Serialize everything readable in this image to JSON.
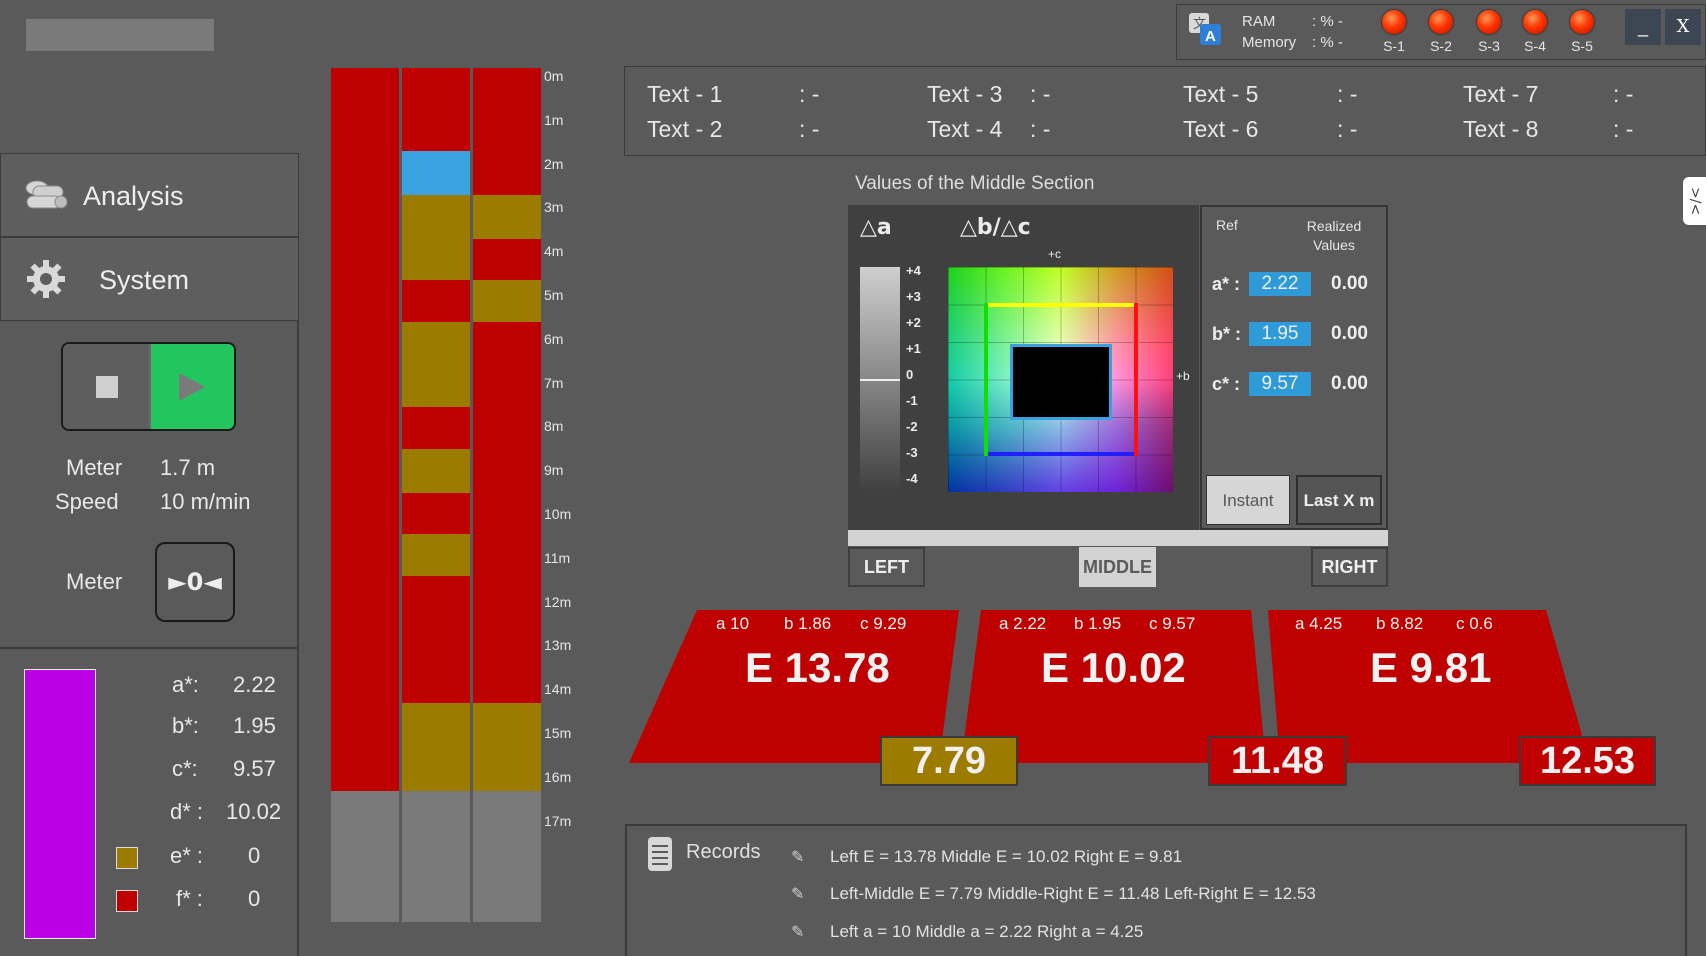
{
  "status": {
    "ram_label": "RAM",
    "ram_value": ": % -",
    "memory_label": "Memory",
    "memory_value": ": % -",
    "sensors": [
      "S-1",
      "S-2",
      "S-3",
      "S-4",
      "S-5"
    ],
    "minimize_label": "_",
    "close_label": "X"
  },
  "text_fields": [
    {
      "label": "Text - 1",
      "value": ": -"
    },
    {
      "label": "Text - 2",
      "value": ": -"
    },
    {
      "label": "Text - 3",
      "value": ": -"
    },
    {
      "label": "Text - 4",
      "value": ": -"
    },
    {
      "label": "Text - 5",
      "value": ": -"
    },
    {
      "label": "Text - 6",
      "value": ": -"
    },
    {
      "label": "Text - 7",
      "value": ": -"
    },
    {
      "label": "Text - 8",
      "value": ": -"
    }
  ],
  "sidebar": {
    "analysis_label": "Analysis",
    "system_label": "System",
    "meter_label": "Meter",
    "meter_value": "1.7 m",
    "speed_label": "Speed",
    "speed_value": "10 m/min",
    "reset_meter_label": "Meter",
    "reset_button_label": "►0◄",
    "values": [
      {
        "label": "a*:",
        "value": "2.22"
      },
      {
        "label": "b*:",
        "value": "1.95"
      },
      {
        "label": "c*:",
        "value": "9.57"
      },
      {
        "label": "d* :",
        "value": "10.02"
      },
      {
        "label": "e* :",
        "value": "0"
      },
      {
        "label": "f* :",
        "value": "0"
      }
    ],
    "preview_color": "#bb00e6",
    "e_color": "#9b7c00",
    "f_color": "#bf0000"
  },
  "strips": {
    "ticks": [
      "0m",
      "1m",
      "2m",
      "3m",
      "4m",
      "5m",
      "6m",
      "7m",
      "8m",
      "9m",
      "10m",
      "11m",
      "12m",
      "13m",
      "14m",
      "15m",
      "16m",
      "17m"
    ],
    "colors": {
      "red": "#bf0000",
      "gold": "#9b7c00",
      "blue": "#3ba3e0",
      "gray": "#7a7a7a"
    }
  },
  "middle": {
    "title": "Values of the Middle Section",
    "delta_a": "△a",
    "delta_bc": "△b/△c",
    "scale_ticks": [
      "+4",
      "+3",
      "+2",
      "+1",
      "0",
      "-1",
      "-2",
      "-3",
      "-4"
    ],
    "plus_c": "+c",
    "plus_b": "+b",
    "ref_label": "Ref",
    "realized_label": "Realized Values",
    "rows": [
      {
        "label": "a* :",
        "ref": "2.22",
        "realized": "0.00"
      },
      {
        "label": "b* :",
        "ref": "1.95",
        "realized": "0.00"
      },
      {
        "label": "c* :",
        "ref": "9.57",
        "realized": "0.00"
      }
    ],
    "instant_label": "Instant",
    "lastx_label": "Last X m",
    "tabs": {
      "left": "LEFT",
      "middle": "MIDDLE",
      "right": "RIGHT"
    }
  },
  "sections": [
    {
      "a": "a 10",
      "b": "b 1.86",
      "c": "c 9.29",
      "e": "E 13.78"
    },
    {
      "a": "a 2.22",
      "b": "b 1.95",
      "c": "c 9.57",
      "e": "E 10.02"
    },
    {
      "a": "a 4.25",
      "b": "b 8.82",
      "c": "c 0.6",
      "e": "E 9.81"
    }
  ],
  "diffs": [
    {
      "value": "7.79",
      "color": "#9b7c00"
    },
    {
      "value": "11.48",
      "color": "#bf0000"
    },
    {
      "value": "12.53",
      "color": "#bf0000"
    }
  ],
  "records": {
    "title": "Records",
    "lines": [
      "Left E = 13.78 Middle E = 10.02 Right E = 9.81",
      "Left-Middle E = 7.79 Middle-Right E = 11.48 Left-Right E = 12.53",
      "Left a = 10 Middle a = 2.22 Right a = 4.25"
    ]
  },
  "side_tab_label": ">/<"
}
